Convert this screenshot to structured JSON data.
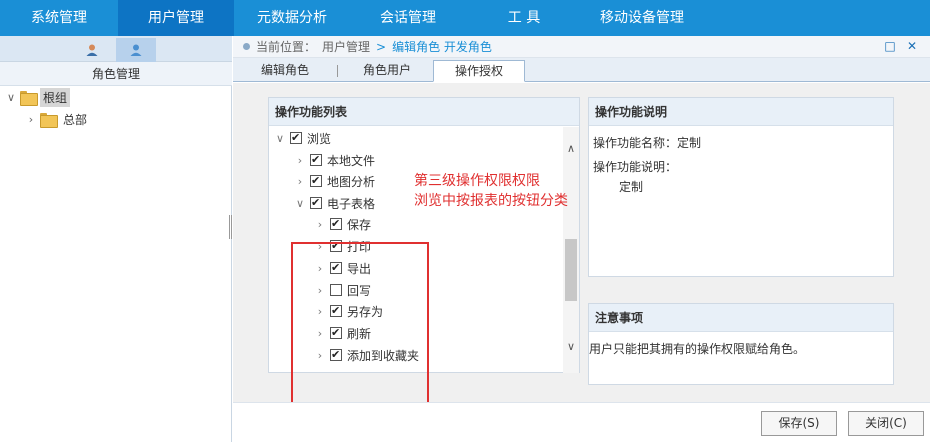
{
  "topnav": {
    "items": [
      {
        "label": "系统管理"
      },
      {
        "label": "用户管理"
      },
      {
        "label": "元数据分析"
      },
      {
        "label": "会话管理"
      },
      {
        "label": "工 具"
      },
      {
        "label": "移动设备管理"
      }
    ],
    "active_index": 1
  },
  "sidebar": {
    "header": "角色管理",
    "tree": [
      {
        "label": "根组",
        "chevron": "v",
        "selected": true
      },
      {
        "label": "总部",
        "chevron": ">"
      }
    ]
  },
  "breadcrumb": {
    "prefix": "当前位置：",
    "path": "用户管理",
    "separator": ">",
    "current": "编辑角色 开发角色"
  },
  "tabs": [
    {
      "label": "编辑角色"
    },
    {
      "label": "角色用户"
    },
    {
      "label": "操作授权"
    }
  ],
  "active_tab": 2,
  "func_list": {
    "title": "操作功能列表",
    "items": [
      {
        "label": "浏览",
        "checked": true,
        "chevron": "v"
      },
      {
        "label": "本地文件",
        "checked": true,
        "chevron": ">"
      },
      {
        "label": "地图分析",
        "checked": true,
        "chevron": ">"
      },
      {
        "label": "电子表格",
        "checked": true,
        "chevron": "v"
      },
      {
        "label": "保存",
        "checked": true,
        "chevron": ">"
      },
      {
        "label": "打印",
        "checked": true,
        "chevron": ">"
      },
      {
        "label": "导出",
        "checked": true,
        "chevron": ">"
      },
      {
        "label": "回写",
        "checked": false,
        "chevron": ">"
      },
      {
        "label": "另存为",
        "checked": true,
        "chevron": ">"
      },
      {
        "label": "刷新",
        "checked": true,
        "chevron": ">"
      },
      {
        "label": "添加到收藏夹",
        "checked": true,
        "chevron": ">"
      }
    ]
  },
  "annotation": {
    "line1": "第三级操作权限权限",
    "line2": "浏览中按报表的按钮分类",
    "color": "#e03030"
  },
  "func_desc": {
    "title": "操作功能说明",
    "name_label": "操作功能名称：",
    "name_value": "定制",
    "desc_label": "操作功能说明：",
    "desc_value": "定制"
  },
  "notice": {
    "title": "注意事项",
    "text": "用户只能把其拥有的操作权限赋给角色。"
  },
  "buttons": {
    "save": "保存(S)",
    "close": "关闭(C)"
  },
  "colors": {
    "nav_bg": "#1a8fd6",
    "nav_active": "#0d74c4",
    "accent": "#1a8fd6"
  }
}
